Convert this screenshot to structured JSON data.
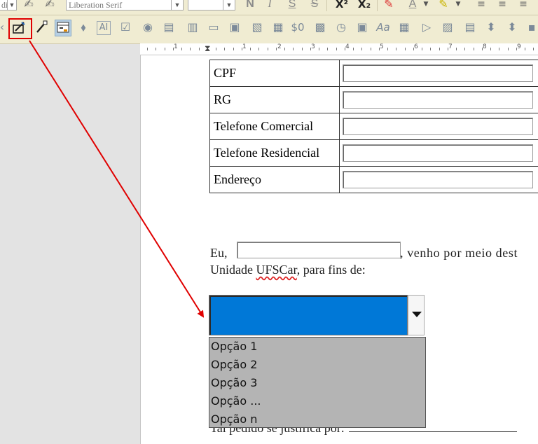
{
  "toolbar": {
    "font_name": "Liberation Serif",
    "paragraph_style_fragment": "di",
    "font_size": "",
    "bold_label": "N",
    "italic_label": "I",
    "underline_label": "S",
    "strike_label": "S",
    "superscript_label": "X²",
    "subscript_label": "X₂",
    "font_color_label": "A",
    "currency_label": "$0",
    "text_box_label": "Aa"
  },
  "form_rows": [
    {
      "label": "CPF"
    },
    {
      "label": "RG"
    },
    {
      "label": "Telefone Comercial"
    },
    {
      "label": "Telefone Residencial"
    },
    {
      "label": "Endereço"
    }
  ],
  "paragraph": {
    "prefix": "Eu,",
    "suffix": ", venho por meio dest",
    "line2_prefix": "Unidade ",
    "line2_underlined": "UFSCar",
    "line2_suffix": ", para fins de:"
  },
  "combobox": {
    "selected_value": "",
    "options": [
      "Opção 1",
      "Opção 2",
      "Opção 3",
      "Opção ...",
      "Opção n"
    ]
  },
  "footer_line": "Tal pedido se justifica por:",
  "ruler_numbers": [
    "1",
    "1",
    "2",
    "3",
    "4",
    "5",
    "6",
    "7",
    "8",
    "9"
  ],
  "colors": {
    "toolbar_bg": "#f0ecd2",
    "highlight_red": "#e00000",
    "combo_selected_blue": "#0078d7",
    "listbox_bg": "#b4b4b4"
  }
}
